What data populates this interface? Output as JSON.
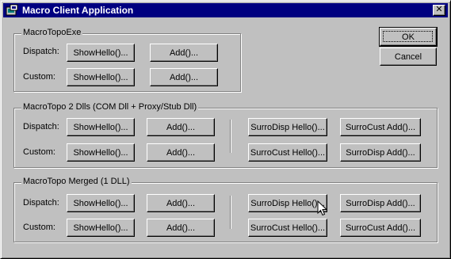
{
  "window": {
    "title": "Macro Client Application",
    "close_symbol": "✕"
  },
  "dialog_buttons": {
    "ok": "OK",
    "cancel": "Cancel"
  },
  "groups": [
    {
      "label": "MacroTopoExe",
      "rows": [
        {
          "label": "Dispatch:",
          "buttons": [
            "ShowHello()...",
            "Add()..."
          ]
        },
        {
          "label": "Custom:",
          "buttons": [
            "ShowHello()...",
            "Add()..."
          ]
        }
      ]
    },
    {
      "label": "MacroTopo 2 Dlls (COM Dll + Proxy/Stub Dll)",
      "rows": [
        {
          "label": "Dispatch:",
          "buttons": [
            "ShowHello()...",
            "Add()...",
            "SurroDisp Hello()...",
            "SurroCust Add()..."
          ]
        },
        {
          "label": "Custom:",
          "buttons": [
            "ShowHello()...",
            "Add()...",
            "SurroCust Hello()...",
            "SurroDisp Add()..."
          ]
        }
      ]
    },
    {
      "label": "MacroTopo Merged (1 DLL)",
      "rows": [
        {
          "label": "Dispatch:",
          "buttons": [
            "ShowHello()...",
            "Add()...",
            "SurroDisp Hello()...",
            "SurroDisp Add()..."
          ]
        },
        {
          "label": "Custom:",
          "buttons": [
            "ShowHello()...",
            "Add()...",
            "SurroCust Hello()...",
            "SurroCust Add()..."
          ]
        }
      ]
    }
  ],
  "colors": {
    "face": "#c0c0c0",
    "titlebar": "#000080",
    "title_text": "#ffffff"
  }
}
